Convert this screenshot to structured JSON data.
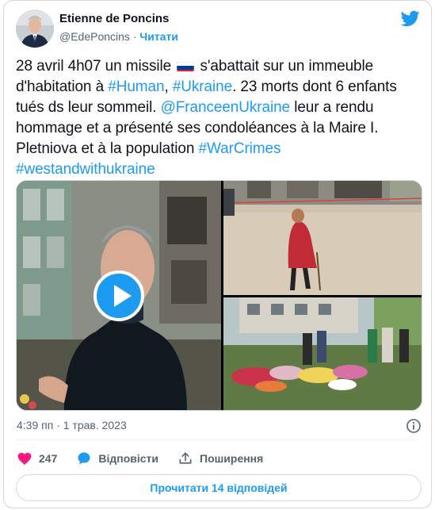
{
  "author": {
    "name": "Etienne de Poncins",
    "handle": "@EdePoncins",
    "separator": "·",
    "follow_label": "Читати"
  },
  "tweet": {
    "segments": [
      {
        "text": "28 avril 4h07 un missile ",
        "link": false
      },
      {
        "text": "",
        "flag": "ru"
      },
      {
        "text": " s'abattait sur un immeuble d'habitation à ",
        "link": false
      },
      {
        "text": "#Human",
        "link": true
      },
      {
        "text": ", ",
        "link": false
      },
      {
        "text": "#Ukraine",
        "link": true
      },
      {
        "text": ". 23 morts dont 6 enfants tués ds leur sommeil. ",
        "link": false
      },
      {
        "text": "@FranceenUkraine",
        "link": true
      },
      {
        "text": " leur a rendu hommage et a présenté ses condoléances à la Maire I. Pletniova et à la population ",
        "link": false
      },
      {
        "text": "#WarCrimes",
        "link": true
      },
      {
        "text": " ",
        "link": false
      },
      {
        "text": "#westandwithukraine",
        "link": true
      }
    ]
  },
  "meta": {
    "timestamp": "4:39 пп · 1 трав. 2023"
  },
  "actions": {
    "like_count": "247",
    "reply_label": "Відповісти",
    "share_label": "Поширення"
  },
  "read_replies_label": "Прочитати 14 відповідей",
  "colors": {
    "accent": "#1d9bf0",
    "like": "#f91880",
    "muted": "#536471"
  }
}
